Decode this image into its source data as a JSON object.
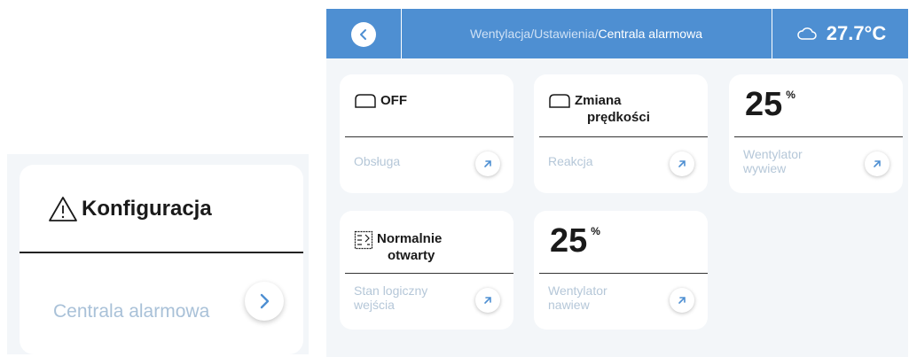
{
  "left_preview": {
    "title": "Konfiguracja",
    "title_icon": "warning-triangle-icon",
    "label": "Centrala alarmowa",
    "arrow_icon": "chevron-right-icon"
  },
  "topbar": {
    "back_icon": "chevron-left-icon",
    "breadcrumb_path": "Wentylacja/Ustawienia/",
    "breadcrumb_current": "Centrala alarmowa",
    "weather_icon": "cloud-icon",
    "temperature": "27.7°C",
    "bar_color": "#4e8fd2"
  },
  "tiles": [
    {
      "head_icon": "mode-box-icon",
      "head_line1": "OFF",
      "head_line2": "",
      "label_line1": "Obsługa",
      "label_line2": "",
      "arrow_icon": "arrow-up-right-icon"
    },
    {
      "head_icon": "mode-box-icon",
      "head_line1": "Zmiana",
      "head_line2": "prędkości",
      "label_line1": "Reakcja",
      "label_line2": "",
      "arrow_icon": "arrow-up-right-icon"
    },
    {
      "value": "25",
      "unit": "%",
      "label_line1": "Wentylator",
      "label_line2": "wywiew",
      "arrow_icon": "arrow-up-right-icon"
    },
    {
      "head_icon": "contact-input-icon",
      "head_line1": "Normalnie",
      "head_line2": "otwarty",
      "label_line1": "Stan logiczny",
      "label_line2": "wejścia",
      "arrow_icon": "arrow-up-right-icon"
    },
    {
      "value": "25",
      "unit": "%",
      "label_line1": "Wentylator",
      "label_line2": "nawiew",
      "arrow_icon": "arrow-up-right-icon"
    }
  ]
}
